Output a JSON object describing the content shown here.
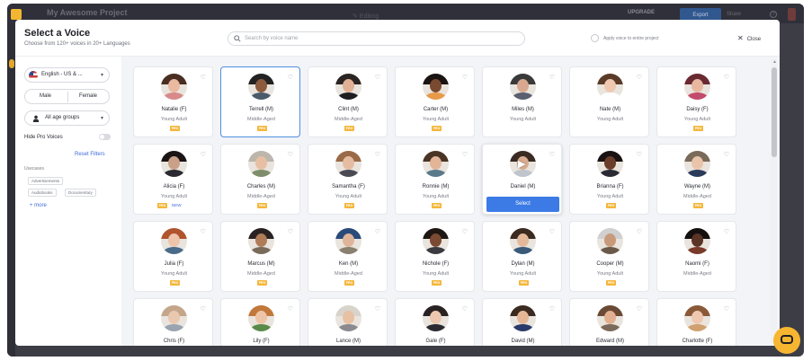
{
  "app": {
    "title": "My Awesome Project",
    "edit_label": "✎ Editing",
    "upgrade_label": "UPGRADE",
    "upgrade_sub": "",
    "export_label": "Export",
    "share_label": "Share",
    "help_label": "?"
  },
  "modal": {
    "title": "Select a Voice",
    "subtitle": "Choose from 120+ voices in 20+ Languages",
    "search_placeholder": "Search by voice name",
    "apply_label": "Apply voice to entire project",
    "close_label": "Close"
  },
  "filters": {
    "language": "English - US & ...",
    "male": "Male",
    "female": "Female",
    "age": "All age groups",
    "hide_pro": "Hide Pro Voices",
    "reset": "Reset Filters",
    "usecases_label": "Usecases",
    "chips": [
      "Advertisements",
      "Audiobooks",
      "Documentary"
    ],
    "more": "+ more"
  },
  "voices": [
    {
      "name": "Natalie (F)",
      "age": "Young Adult",
      "pro": true,
      "skin": "#e9b9a0",
      "hair": "#4a2e22",
      "shirt": "#d88a8a"
    },
    {
      "name": "Terrell (M)",
      "age": "Middle-Aged",
      "pro": true,
      "skin": "#8c5a3c",
      "hair": "#222222",
      "shirt": "#4a5a6a",
      "selected": true
    },
    {
      "name": "Clint (M)",
      "age": "Middle-Aged",
      "pro": true,
      "skin": "#e0b094",
      "hair": "#2a2422",
      "shirt": "#1e1e22"
    },
    {
      "name": "Carter (M)",
      "age": "Young Adult",
      "pro": true,
      "skin": "#7a4a30",
      "hair": "#1a1412",
      "shirt": "#e89a4a"
    },
    {
      "name": "Miles (M)",
      "age": "Young Adult",
      "pro": false,
      "skin": "#d8a890",
      "hair": "#3a3a3a",
      "shirt": "#5a6070"
    },
    {
      "name": "Nate (M)",
      "age": "Young Adult",
      "pro": false,
      "skin": "#f0c8b0",
      "hair": "#5a3a28",
      "shirt": "#ffffff"
    },
    {
      "name": "Daisy (F)",
      "age": "Young Adult",
      "pro": true,
      "skin": "#e9b8a0",
      "hair": "#6a2a32",
      "shirt": "#c24a6a"
    },
    {
      "name": "Alicia (F)",
      "age": "Young Adult",
      "pro": true,
      "new": "NEW",
      "skin": "#caa088",
      "hair": "#1a1414",
      "shirt": "#2a2a30"
    },
    {
      "name": "Charles (M)",
      "age": "Middle-Aged",
      "pro": true,
      "skin": "#e7c0a4",
      "hair": "#bcb6ac",
      "shirt": "#7e8e6a"
    },
    {
      "name": "Samantha (F)",
      "age": "Young Adult",
      "pro": true,
      "skin": "#e5bca2",
      "hair": "#9a6a48",
      "shirt": "#4a4a54"
    },
    {
      "name": "Ronnie (M)",
      "age": "Young Adult",
      "pro": true,
      "skin": "#e2b498",
      "hair": "#4a3424",
      "shirt": "#5a7a8a"
    },
    {
      "name": "Daniel (M)",
      "age": "",
      "pro": false,
      "skin": "#d8ac90",
      "hair": "#3a2a22",
      "shirt": "#c0c4cc",
      "hover": true,
      "select_label": "Select"
    },
    {
      "name": "Brianna (F)",
      "age": "Young Adult",
      "pro": true,
      "skin": "#6a3e2a",
      "hair": "#1a1212",
      "shirt": "#2a2a34"
    },
    {
      "name": "Wayne (M)",
      "age": "Middle-Aged",
      "pro": true,
      "skin": "#eac4aa",
      "hair": "#7a6a5a",
      "shirt": "#2a3a5a"
    },
    {
      "name": "Julia (F)",
      "age": "Young Adult",
      "pro": true,
      "skin": "#eec4aa",
      "hair": "#b0542e",
      "shirt": "#4a6a8a"
    },
    {
      "name": "Marcus (M)",
      "age": "Middle-Aged",
      "pro": true,
      "skin": "#b07c58",
      "hair": "#2a2222",
      "shirt": "#7a6a5a"
    },
    {
      "name": "Ken (M)",
      "age": "Middle-Aged",
      "pro": true,
      "skin": "#e0b498",
      "hair": "#2a4a7a",
      "shirt": "#8a8070"
    },
    {
      "name": "Nichole (F)",
      "age": "Young Adult",
      "pro": true,
      "skin": "#7a4a32",
      "hair": "#1e1612",
      "shirt": "#3a3a40"
    },
    {
      "name": "Dylan (M)",
      "age": "Young Adult",
      "pro": true,
      "skin": "#e4b89a",
      "hair": "#3a2a20",
      "shirt": "#3a5a7a"
    },
    {
      "name": "Cooper (M)",
      "age": "Young Adult",
      "pro": true,
      "skin": "#c89a7a",
      "hair": "#d0d0d0",
      "shirt": "#6a5a4a"
    },
    {
      "name": "Naomi (F)",
      "age": "Middle-Aged",
      "pro": false,
      "skin": "#5a3424",
      "hair": "#141010",
      "shirt": "#7a3a2a"
    },
    {
      "name": "Chris (F)",
      "age": "",
      "pro": false,
      "skin": "#eac8b0",
      "hair": "#c4a68a",
      "shirt": "#9aa4b0"
    },
    {
      "name": "Lily (F)",
      "age": "",
      "pro": false,
      "skin": "#eec4a8",
      "hair": "#c2783a",
      "shirt": "#5a8a4a"
    },
    {
      "name": "Lance (M)",
      "age": "",
      "pro": false,
      "skin": "#e8c0a4",
      "hair": "#d8d4cc",
      "shirt": "#8a8a90"
    },
    {
      "name": "Gale (F)",
      "age": "",
      "pro": false,
      "skin": "#ecc6ae",
      "hair": "#2a2222",
      "shirt": "#2a2a30"
    },
    {
      "name": "David (M)",
      "age": "",
      "pro": false,
      "skin": "#e4b696",
      "hair": "#3a2a20",
      "shirt": "#2a3a6a"
    },
    {
      "name": "Edward (M)",
      "age": "",
      "pro": false,
      "skin": "#e2b090",
      "hair": "#6a4a34",
      "shirt": "#7a6a5a"
    },
    {
      "name": "Charlotte (F)",
      "age": "",
      "pro": false,
      "skin": "#eec8b0",
      "hair": "#8a5a38",
      "shirt": "#d0a070"
    }
  ],
  "pro_label": "PRO"
}
